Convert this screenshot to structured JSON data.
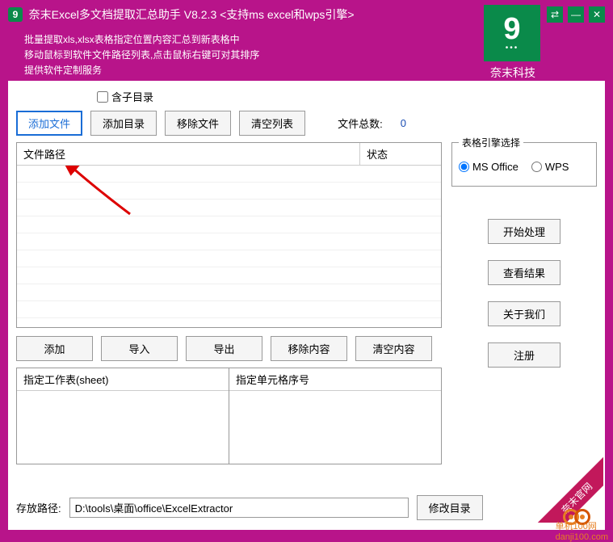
{
  "title": "奈末Excel多文档提取汇总助手  V8.2.3  <支持ms  excel和wps引擎>",
  "desc_line1": "批量提取xls,xlsx表格指定位置内容汇总到新表格中",
  "desc_line2": "移动鼠标到软件文件路径列表,点击鼠标右键可对其排序",
  "desc_line3": "提供软件定制服务",
  "logo_text": "奈末科技",
  "checkbox_sub": "含子目录",
  "buttons": {
    "add_file": "添加文件",
    "add_dir": "添加目录",
    "remove_file": "移除文件",
    "clear_list": "清空列表"
  },
  "file_count_label": "文件总数:",
  "file_count_value": "0",
  "table": {
    "col_path": "文件路径",
    "col_status": "状态"
  },
  "engine": {
    "title": "表格引擎选择",
    "ms": "MS Office",
    "wps": "WPS"
  },
  "actions": {
    "start": "开始处理",
    "view": "查看结果",
    "about": "关于我们",
    "register": "注册"
  },
  "mid_buttons": {
    "add": "添加",
    "import": "导入",
    "export": "导出",
    "remove": "移除内容",
    "clear": "清空内容"
  },
  "sheets": {
    "sheet_label": "指定工作表(sheet)",
    "cell_label": "指定单元格序号"
  },
  "save_path_label": "存放路径:",
  "save_path_value": "D:\\tools\\桌面\\office\\ExcelExtractor",
  "modify_dir": "修改目录",
  "ribbon": "奈末官网",
  "corner_site": "danji100.com",
  "corner_brand": "单机100网"
}
